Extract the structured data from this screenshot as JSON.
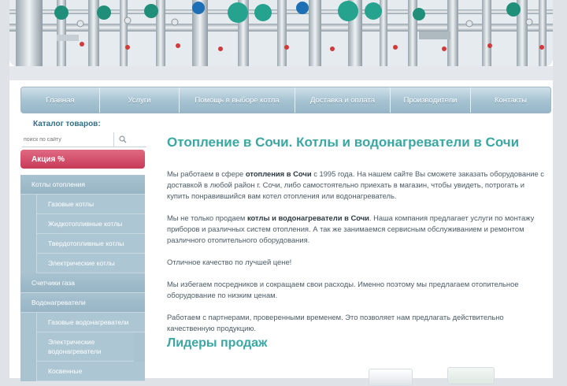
{
  "nav": {
    "items": [
      {
        "label": "Главная"
      },
      {
        "label": "Услуги"
      },
      {
        "label": "Помощь в выборе котла"
      },
      {
        "label": "Доставка и оплата"
      },
      {
        "label": "Производители"
      },
      {
        "label": "Контакты"
      }
    ]
  },
  "sidebar": {
    "catalog_title": "Каталог товаров:",
    "search_placeholder": "поиск по сайту",
    "promo_label": "Акция %",
    "menu": [
      {
        "label": "Котлы отопления",
        "level": "top"
      },
      {
        "label": "Газовые котлы",
        "level": "sub"
      },
      {
        "label": "Жидкотопливные котлы",
        "level": "sub"
      },
      {
        "label": "Твердотопливные котлы",
        "level": "sub"
      },
      {
        "label": "Электрические котлы",
        "level": "sub"
      },
      {
        "label": "Счетчики газа",
        "level": "top"
      },
      {
        "label": "Водонагреватели",
        "level": "top"
      },
      {
        "label": "Газовые водонагреватели",
        "level": "sub"
      },
      {
        "label": "Электрические водонагреватели",
        "level": "sub"
      },
      {
        "label": "Косвенные",
        "level": "sub"
      }
    ]
  },
  "content": {
    "title": "Отопление в Сочи. Котлы и водонагреватели в Сочи",
    "p1": {
      "a": "Мы работаем в сфере ",
      "b": "отопления в Сочи",
      "c": " с 1995 года. На нашем сайте Вы сможете заказать оборудование с доставкой в любой район г. Сочи, либо самостоятельно приехать в магазин, чтобы увидеть, потрогать и купить понравившийся вам котел отопления или водонагреватель."
    },
    "p2": {
      "a": "Мы не только продаем ",
      "b": "котлы и водонагреватели в Сочи",
      "c": ". Наша компания предлагает услуги по монтажу приборов и различных систем отопления. А так же занимаемся сервисным обслуживанием и ремонтом различного отопительного оборудования."
    },
    "p3": "Отличное качество по лучшей цене!",
    "p4": "Мы избегаем посредников и сокращаем свои расходы. Именно поэтому мы предлагаем отопительное оборудование по низким ценам.",
    "p5": "Работаем с партнерами, проверенными временем. Это позволяет нам предлагать действительно качественную продукцию.",
    "leaders_title": "Лидеры продаж"
  }
}
